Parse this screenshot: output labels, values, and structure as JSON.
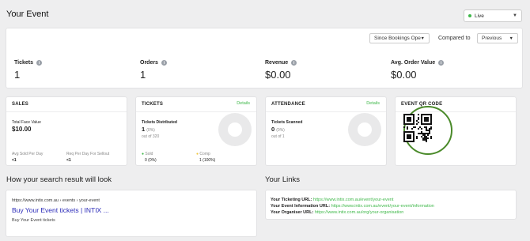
{
  "header": {
    "title": "Your Event",
    "status": "Live"
  },
  "summary": {
    "period_select": "Since Bookings Open",
    "compared_label": "Compared to",
    "compare_select": "Previous",
    "metrics": [
      {
        "label": "Tickets",
        "value": "1"
      },
      {
        "label": "Orders",
        "value": "1"
      },
      {
        "label": "Revenue",
        "value": "$0.00"
      },
      {
        "label": "Avg. Order Value",
        "value": "$0.00"
      }
    ]
  },
  "sales": {
    "title": "SALES",
    "face_label": "Total Face Value",
    "face_value": "$10.00",
    "avg_label": "Avg Sold Per Day",
    "avg_value": "<1",
    "req_label": "Req Per Day For Sellout",
    "req_value": "<1"
  },
  "tickets": {
    "title": "TICKETS",
    "details": "Details",
    "dist_label": "Tickets Distributed",
    "dist_value": "1",
    "dist_pct": "(0%)",
    "dist_of": "out of 320",
    "sold_label": "Sold",
    "sold_value": "0 (0%)",
    "comp_label": "Comp",
    "comp_value": "1 (100%)"
  },
  "attendance": {
    "title": "ATTENDANCE",
    "details": "Details",
    "scan_label": "Tickets Scanned",
    "scan_value": "0",
    "scan_pct": "(0%)",
    "scan_of": "out of 1"
  },
  "qr": {
    "title": "EVENT QR CODE"
  },
  "search": {
    "title": "How your search result will look",
    "url": "https://www.intix.com.au › events › your-event",
    "result_title": "Buy Your Event tickets | INTIX ...",
    "description": "Buy Your Event tickets"
  },
  "links": {
    "title": "Your Links",
    "ticketing_label": "Your Ticketing URL:",
    "ticketing_url": "https://www.intix.com.au/event/your-event",
    "info_label": "Your Event Information URL:",
    "info_url": "https://www.intix.com.au/event/your-event/information",
    "organiser_label": "Your Organiser URL:",
    "organiser_url": "https://www.intix.com.au/org/your-organisation"
  },
  "colors": {
    "accent": "#3fb84a",
    "link": "#2a2ab8",
    "background": "#eeeeef"
  }
}
